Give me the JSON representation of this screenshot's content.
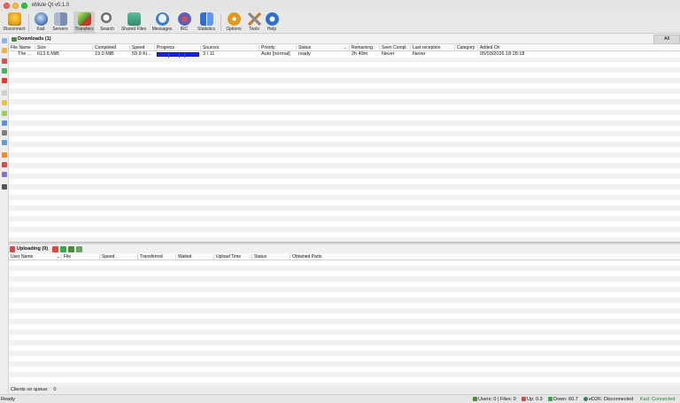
{
  "window": {
    "title": "eMule Qt v0.1.0"
  },
  "toolbar": {
    "items": [
      {
        "label": "Disconnect",
        "icon": "disconnect-icon",
        "color": "#e8a21a"
      },
      {
        "label": "Kad",
        "icon": "kad-icon",
        "color": "#3b6fb6"
      },
      {
        "label": "Servers",
        "icon": "servers-icon",
        "color": "#7a8fb0"
      },
      {
        "label": "Transfers",
        "icon": "transfers-icon",
        "color": "#3f9b3a"
      },
      {
        "label": "Search",
        "icon": "search-icon",
        "color": "#6d6d6d"
      },
      {
        "label": "Shared Files",
        "icon": "shared-files-icon",
        "color": "#2f8a6e"
      },
      {
        "label": "Messages",
        "icon": "messages-icon",
        "color": "#3c7cc9"
      },
      {
        "label": "IRC",
        "icon": "irc-icon",
        "color": "#5a5fbf"
      },
      {
        "label": "Statistics",
        "icon": "statistics-icon",
        "color": "#2e6fd0"
      },
      {
        "label": "Options",
        "icon": "options-icon",
        "color": "#e09a1e"
      },
      {
        "label": "Tools",
        "icon": "tools-icon",
        "color": "#8a8a8a"
      },
      {
        "label": "Help",
        "icon": "help-icon",
        "color": "#2d6fd3"
      }
    ]
  },
  "downloads": {
    "title": "Downloads (1)",
    "category_tab": "All",
    "columns": [
      "File Name",
      "Size",
      "Completed",
      "Speed",
      "Progress",
      "Sources",
      "Priority",
      "Status",
      "Remaining",
      "Seen Compl.",
      "Last reception",
      "Category",
      "Added On"
    ],
    "rows": [
      {
        "file_name": "The ...",
        "size": "613.6 MiB",
        "completed": "19.0 MiB",
        "speed": "59.9 Ki...",
        "progress_fraction": 0.03,
        "sources": "3 / 11",
        "priority": "Auto [normal]",
        "status": "ready",
        "remaining": "2h 49m",
        "seen_complete": "Never",
        "last_reception": "Never",
        "category": "",
        "added_on": "05/03/2026 18:28:18"
      }
    ]
  },
  "uploads": {
    "title": "Uploading (0)",
    "columns": [
      "User Name",
      "File",
      "Speed",
      "Transferred",
      "Waited",
      "Upload Time",
      "Status",
      "Obtained Parts"
    ],
    "clients_on_queue_label": "Clients on queue:",
    "clients_on_queue_value": "0"
  },
  "statusbar": {
    "ready": "Ready",
    "users_files": "Users: 0 | Files: 0",
    "up": "Up: 0.3",
    "down": "Down: 60.7",
    "ed2k": "eD2K: Disconnected",
    "kad": "Kad: Connected",
    "kad_color": "#1f8a2a"
  }
}
